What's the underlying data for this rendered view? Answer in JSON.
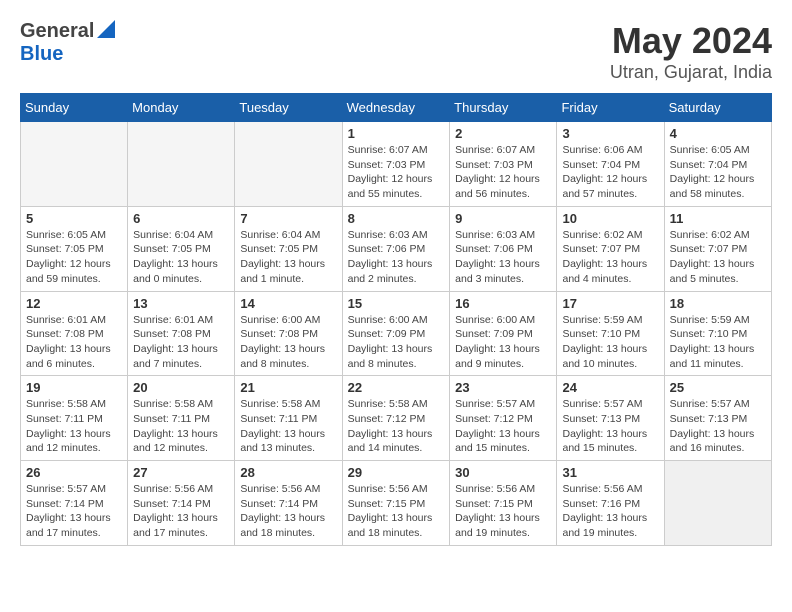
{
  "header": {
    "logo_general": "General",
    "logo_blue": "Blue",
    "month_year": "May 2024",
    "location": "Utran, Gujarat, India"
  },
  "days_of_week": [
    "Sunday",
    "Monday",
    "Tuesday",
    "Wednesday",
    "Thursday",
    "Friday",
    "Saturday"
  ],
  "weeks": [
    [
      {
        "num": "",
        "info": ""
      },
      {
        "num": "",
        "info": ""
      },
      {
        "num": "",
        "info": ""
      },
      {
        "num": "1",
        "info": "Sunrise: 6:07 AM\nSunset: 7:03 PM\nDaylight: 12 hours\nand 55 minutes."
      },
      {
        "num": "2",
        "info": "Sunrise: 6:07 AM\nSunset: 7:03 PM\nDaylight: 12 hours\nand 56 minutes."
      },
      {
        "num": "3",
        "info": "Sunrise: 6:06 AM\nSunset: 7:04 PM\nDaylight: 12 hours\nand 57 minutes."
      },
      {
        "num": "4",
        "info": "Sunrise: 6:05 AM\nSunset: 7:04 PM\nDaylight: 12 hours\nand 58 minutes."
      }
    ],
    [
      {
        "num": "5",
        "info": "Sunrise: 6:05 AM\nSunset: 7:05 PM\nDaylight: 12 hours\nand 59 minutes."
      },
      {
        "num": "6",
        "info": "Sunrise: 6:04 AM\nSunset: 7:05 PM\nDaylight: 13 hours\nand 0 minutes."
      },
      {
        "num": "7",
        "info": "Sunrise: 6:04 AM\nSunset: 7:05 PM\nDaylight: 13 hours\nand 1 minute."
      },
      {
        "num": "8",
        "info": "Sunrise: 6:03 AM\nSunset: 7:06 PM\nDaylight: 13 hours\nand 2 minutes."
      },
      {
        "num": "9",
        "info": "Sunrise: 6:03 AM\nSunset: 7:06 PM\nDaylight: 13 hours\nand 3 minutes."
      },
      {
        "num": "10",
        "info": "Sunrise: 6:02 AM\nSunset: 7:07 PM\nDaylight: 13 hours\nand 4 minutes."
      },
      {
        "num": "11",
        "info": "Sunrise: 6:02 AM\nSunset: 7:07 PM\nDaylight: 13 hours\nand 5 minutes."
      }
    ],
    [
      {
        "num": "12",
        "info": "Sunrise: 6:01 AM\nSunset: 7:08 PM\nDaylight: 13 hours\nand 6 minutes."
      },
      {
        "num": "13",
        "info": "Sunrise: 6:01 AM\nSunset: 7:08 PM\nDaylight: 13 hours\nand 7 minutes."
      },
      {
        "num": "14",
        "info": "Sunrise: 6:00 AM\nSunset: 7:08 PM\nDaylight: 13 hours\nand 8 minutes."
      },
      {
        "num": "15",
        "info": "Sunrise: 6:00 AM\nSunset: 7:09 PM\nDaylight: 13 hours\nand 8 minutes."
      },
      {
        "num": "16",
        "info": "Sunrise: 6:00 AM\nSunset: 7:09 PM\nDaylight: 13 hours\nand 9 minutes."
      },
      {
        "num": "17",
        "info": "Sunrise: 5:59 AM\nSunset: 7:10 PM\nDaylight: 13 hours\nand 10 minutes."
      },
      {
        "num": "18",
        "info": "Sunrise: 5:59 AM\nSunset: 7:10 PM\nDaylight: 13 hours\nand 11 minutes."
      }
    ],
    [
      {
        "num": "19",
        "info": "Sunrise: 5:58 AM\nSunset: 7:11 PM\nDaylight: 13 hours\nand 12 minutes."
      },
      {
        "num": "20",
        "info": "Sunrise: 5:58 AM\nSunset: 7:11 PM\nDaylight: 13 hours\nand 12 minutes."
      },
      {
        "num": "21",
        "info": "Sunrise: 5:58 AM\nSunset: 7:11 PM\nDaylight: 13 hours\nand 13 minutes."
      },
      {
        "num": "22",
        "info": "Sunrise: 5:58 AM\nSunset: 7:12 PM\nDaylight: 13 hours\nand 14 minutes."
      },
      {
        "num": "23",
        "info": "Sunrise: 5:57 AM\nSunset: 7:12 PM\nDaylight: 13 hours\nand 15 minutes."
      },
      {
        "num": "24",
        "info": "Sunrise: 5:57 AM\nSunset: 7:13 PM\nDaylight: 13 hours\nand 15 minutes."
      },
      {
        "num": "25",
        "info": "Sunrise: 5:57 AM\nSunset: 7:13 PM\nDaylight: 13 hours\nand 16 minutes."
      }
    ],
    [
      {
        "num": "26",
        "info": "Sunrise: 5:57 AM\nSunset: 7:14 PM\nDaylight: 13 hours\nand 17 minutes."
      },
      {
        "num": "27",
        "info": "Sunrise: 5:56 AM\nSunset: 7:14 PM\nDaylight: 13 hours\nand 17 minutes."
      },
      {
        "num": "28",
        "info": "Sunrise: 5:56 AM\nSunset: 7:14 PM\nDaylight: 13 hours\nand 18 minutes."
      },
      {
        "num": "29",
        "info": "Sunrise: 5:56 AM\nSunset: 7:15 PM\nDaylight: 13 hours\nand 18 minutes."
      },
      {
        "num": "30",
        "info": "Sunrise: 5:56 AM\nSunset: 7:15 PM\nDaylight: 13 hours\nand 19 minutes."
      },
      {
        "num": "31",
        "info": "Sunrise: 5:56 AM\nSunset: 7:16 PM\nDaylight: 13 hours\nand 19 minutes."
      },
      {
        "num": "",
        "info": ""
      }
    ]
  ]
}
